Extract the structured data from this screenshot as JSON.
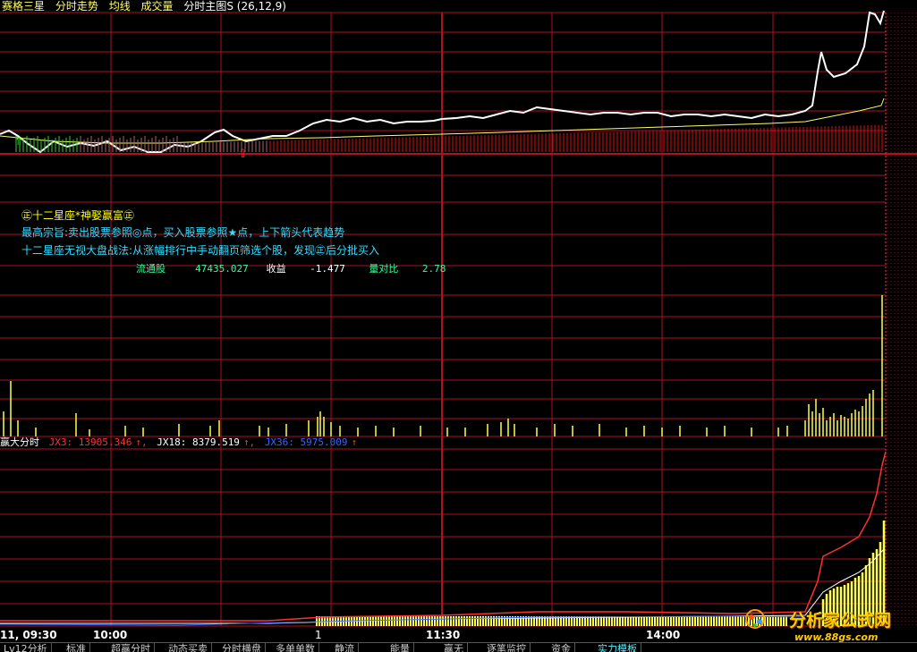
{
  "header": {
    "stock_name": "赛格三星",
    "items": [
      "分时走势",
      "均线",
      "成交量",
      "分时主图S (26,12,9)"
    ]
  },
  "info_box": {
    "line1": "㊣十二星座*神娶赢富㊣",
    "line2": "最高宗旨:卖出股票参照◎点，买入股票参照★点，上下箭头代表趋势",
    "line3": "十二星座无视大盘战法:从涨幅排行中手动翻页筛选个股，发现㊣后分批买入"
  },
  "stats": {
    "float_label": "流通股",
    "float_value": "47435.027",
    "eps_label": "收益",
    "eps_value": "-1.477",
    "ratio_label": "量对比",
    "ratio_value": "2.78"
  },
  "indicator": {
    "name": "赢大分时",
    "jx3": "JX3: 13905.346",
    "jx18": "JX18: 8379.519",
    "jx36": "JX36: 5975.009"
  },
  "x_axis": {
    "start": "11, 09:30",
    "t1": "10:00",
    "mid_mark": "1",
    "t2": "11:30",
    "t3": "14:00"
  },
  "tabs": [
    "Lv12分析",
    "标准",
    "超赢分时",
    "动态买卖",
    "分时横盘",
    "多单单数",
    "静流",
    "能量",
    "赢无",
    "逐笔监控",
    "资金",
    "实力模板"
  ],
  "watermark": {
    "site": "分析家公式网",
    "url": "www.88gs.com"
  },
  "colors": {
    "grid": "#b01020",
    "price": "#ffffff",
    "avg": "#ffff66",
    "volume": "#ffff44",
    "up_bar": "#e01010",
    "jx3": "#ff3030",
    "jx18": "#ffffff",
    "jx36": "#3366ff",
    "info_title": "#ffff00",
    "info_text": "#33ddff",
    "stats_text": "#33ff99"
  }
}
